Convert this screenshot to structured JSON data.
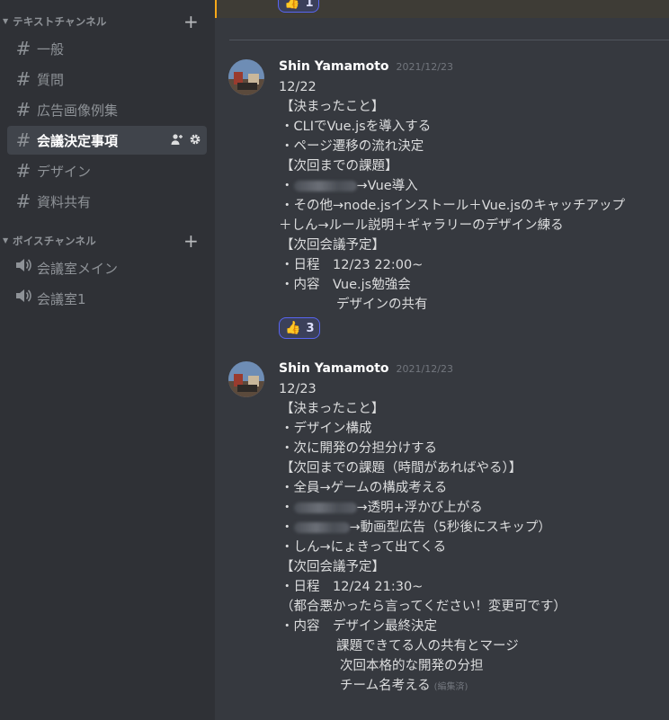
{
  "sidebar": {
    "text_category": {
      "label": "テキストチャンネル",
      "add_icon": "plus-icon"
    },
    "text_channels": [
      {
        "label": "一般"
      },
      {
        "label": "質問"
      },
      {
        "label": "広告画像例集"
      },
      {
        "label": "会議決定事項",
        "active": true
      },
      {
        "label": "デザイン"
      },
      {
        "label": "資料共有"
      }
    ],
    "voice_category": {
      "label": "ボイスチャンネル",
      "add_icon": "plus-icon"
    },
    "voice_channels": [
      {
        "label": "会議室メイン"
      },
      {
        "label": "会議室1"
      }
    ]
  },
  "top_reaction": {
    "emoji": "👍",
    "count": "1"
  },
  "messages": [
    {
      "author": "Shin Yamamoto",
      "timestamp": "2021/12/23",
      "lines": [
        "12/22",
        "【決まったこと】",
        "・CLIでVue.jsを導入する",
        "・ページ遷移の流れ決定",
        "【次回までの課題】",
        "→Vue導入",
        "・その他→node.jsインストール＋Vue.jsのキャッチアップ",
        "＋しん→ルール説明＋ギャラリーのデザイン練る",
        "【次回会議予定】",
        "・日程　12/23 22:00~",
        "・内容　Vue.js勉強会",
        "デザインの共有"
      ],
      "reaction": {
        "emoji": "👍",
        "count": "3"
      }
    },
    {
      "author": "Shin Yamamoto",
      "timestamp": "2021/12/23",
      "lines": [
        "12/23",
        "【決まったこと】",
        "・デザイン構成",
        "・次に開発の分担分けする",
        "【次回までの課題（時間があればやる）】",
        "・全員→ゲームの構成考える",
        "→透明+浮かび上がる",
        "→動画型広告（5秒後にスキップ）",
        "・しん→にょきって出てくる",
        "【次回会議予定】",
        "・日程　12/24 21:30~",
        "（都合悪かったら言ってください！変更可です）",
        "・内容　デザイン最終決定",
        "課題できてる人の共有とマージ",
        "次回本格的な開発の分担",
        "チーム名考える"
      ],
      "edited": "(編集済)"
    }
  ],
  "colors": {
    "sidebar_bg": "#2f3136",
    "main_bg": "#36393f",
    "active_channel": "#40444b",
    "reaction_border": "#5865f2",
    "highlight_bar": "#faa81a"
  }
}
